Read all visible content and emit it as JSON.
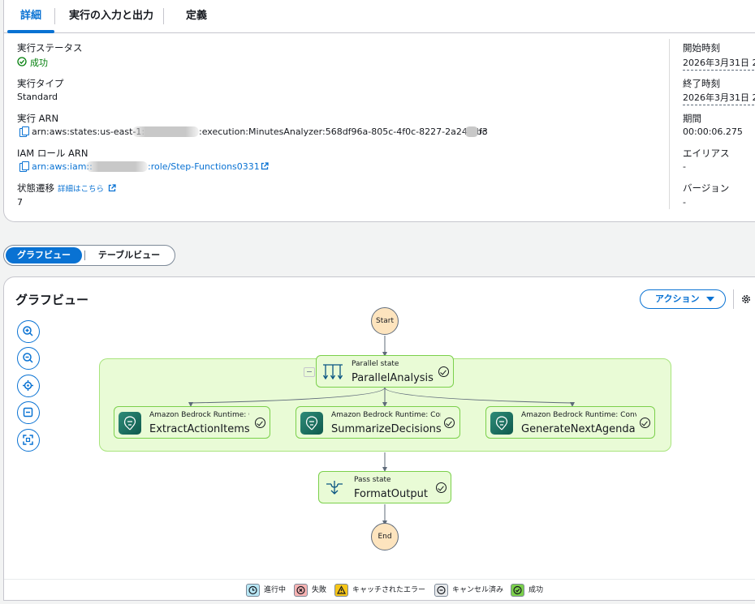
{
  "tabs": [
    {
      "label": "詳細"
    },
    {
      "label": "実行の入力と出力"
    },
    {
      "label": "定義"
    }
  ],
  "details": {
    "status_label": "実行ステータス",
    "status_value": "成功",
    "type_label": "実行タイプ",
    "type_value": "Standard",
    "arn_label": "実行 ARN",
    "arn_prefix": "arn:aws:states:us-east-1:",
    "arn_suffix": ":execution:MinutesAnalyzer:568df96a-805c-4f0c-8227-2a24f0bc",
    "arn_tail": "f3",
    "role_label": "IAM ロール ARN",
    "role_prefix": "arn:aws:iam::",
    "role_suffix": ":role/Step-Functions0331",
    "transition_label": "状態遷移",
    "transition_link": "詳細はこちら",
    "transition_value": "7",
    "start_label": "開始時刻",
    "start_value": "2026年3月31日 2",
    "end_label": "終了時刻",
    "end_value": "2026年3月31日 2",
    "duration_label": "期間",
    "duration_value": "00:00:06.275",
    "alias_label": "エイリアス",
    "alias_value": "-",
    "version_label": "バージョン",
    "version_value": "-"
  },
  "view_toggle": {
    "graph": "グラフビュー",
    "table": "テーブルビュー"
  },
  "graph": {
    "title": "グラフビュー",
    "action_label": "アクション",
    "start": "Start",
    "end": "End",
    "parallel": {
      "sub": "Parallel state",
      "name": "ParallelAnalysis"
    },
    "branches": [
      {
        "sub": "Amazon Bedrock Runtime: C",
        "name": "ExtractActionItems"
      },
      {
        "sub": "Amazon Bedrock Runtime: Con",
        "name": "SummarizeDecisions"
      },
      {
        "sub": "Amazon Bedrock Runtime: Conv",
        "name": "GenerateNextAgenda"
      }
    ],
    "pass": {
      "sub": "Pass state",
      "name": "FormatOutput"
    }
  },
  "legend": [
    {
      "label": "進行中",
      "color": "#b8e7f5",
      "icon": "clock-icon"
    },
    {
      "label": "失敗",
      "color": "#f8b3b3",
      "icon": "x-icon"
    },
    {
      "label": "キャッチされたエラー",
      "color": "#f5c518",
      "icon": "warning-icon"
    },
    {
      "label": "キャンセル済み",
      "color": "#e9ebed",
      "icon": "minus-icon"
    },
    {
      "label": "成功",
      "color": "#7bd04b",
      "icon": "check-icon"
    }
  ]
}
